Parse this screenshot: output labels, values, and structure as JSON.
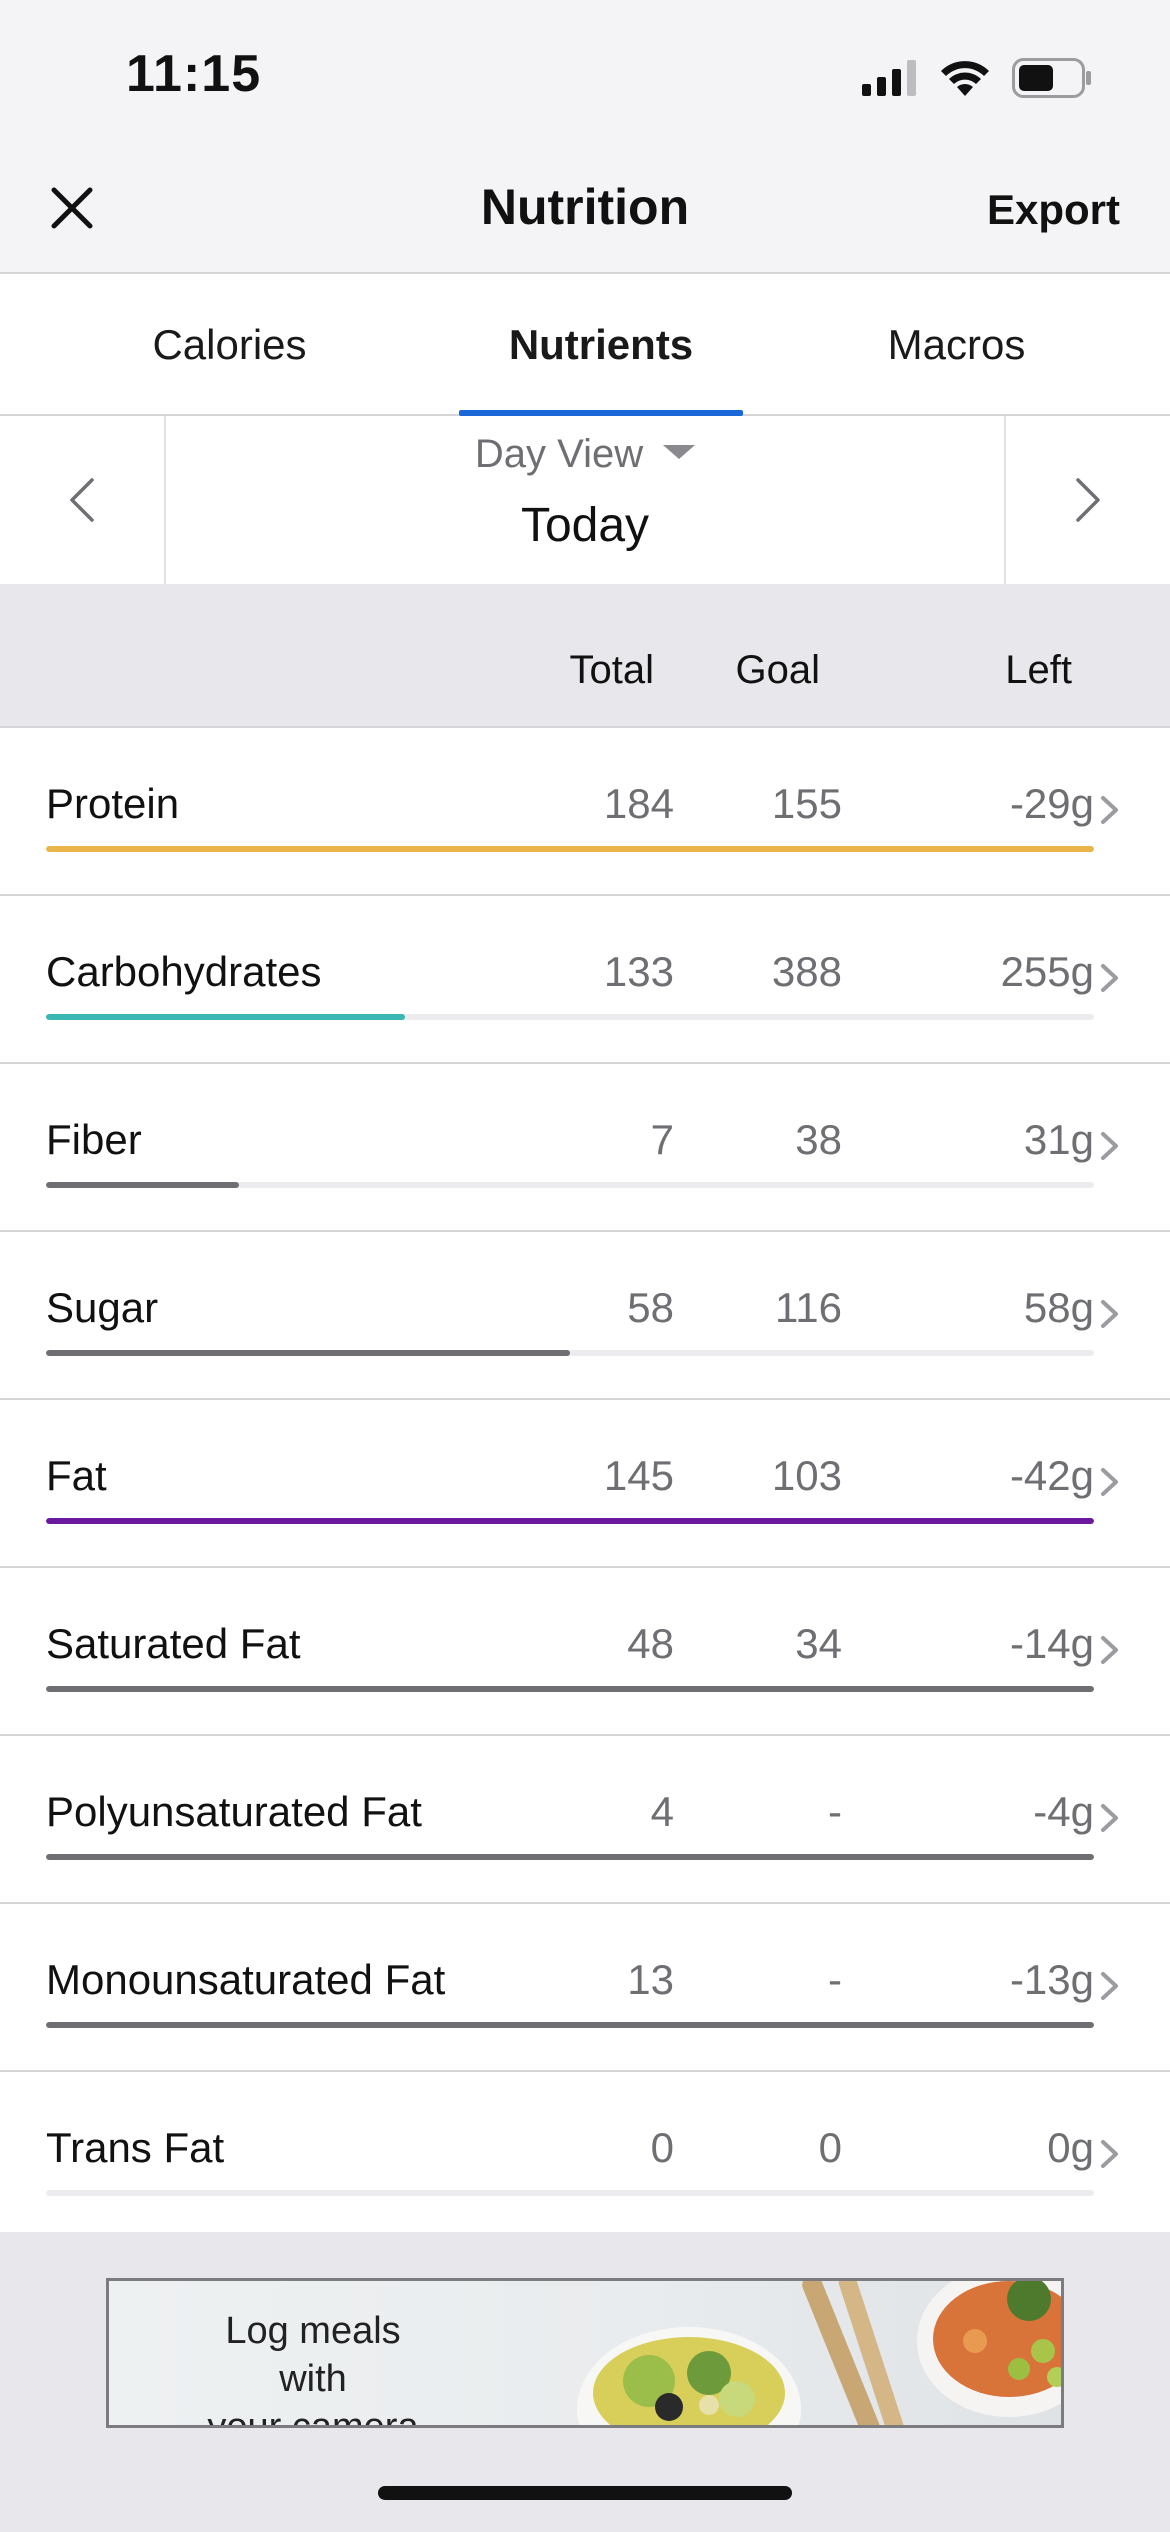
{
  "status_bar": {
    "time": "11:15"
  },
  "header": {
    "title": "Nutrition",
    "export_label": "Export"
  },
  "tabs": [
    {
      "label": "Calories",
      "active": false
    },
    {
      "label": "Nutrients",
      "active": true
    },
    {
      "label": "Macros",
      "active": false
    }
  ],
  "date_nav": {
    "view_label": "Day View",
    "day_label": "Today"
  },
  "columns": {
    "total": "Total",
    "goal": "Goal",
    "left": "Left"
  },
  "nutrients": [
    {
      "name": "Protein",
      "total": "184",
      "goal": "155",
      "left": "-29g",
      "progress": 1.0,
      "color": "#eab54a"
    },
    {
      "name": "Carbohydrates",
      "total": "133",
      "goal": "388",
      "left": "255g",
      "progress": 0.343,
      "color": "#3ab7b3"
    },
    {
      "name": "Fiber",
      "total": "7",
      "goal": "38",
      "left": "31g",
      "progress": 0.184,
      "color": "#6f6f73"
    },
    {
      "name": "Sugar",
      "total": "58",
      "goal": "116",
      "left": "58g",
      "progress": 0.5,
      "color": "#6f6f73"
    },
    {
      "name": "Fat",
      "total": "145",
      "goal": "103",
      "left": "-42g",
      "progress": 1.0,
      "color": "#6b1a9e"
    },
    {
      "name": "Saturated Fat",
      "total": "48",
      "goal": "34",
      "left": "-14g",
      "progress": 1.0,
      "color": "#6f6f73"
    },
    {
      "name": "Polyunsaturated Fat",
      "total": "4",
      "goal": "-",
      "left": "-4g",
      "progress": 1.0,
      "color": "#6f6f73"
    },
    {
      "name": "Monounsaturated Fat",
      "total": "13",
      "goal": "-",
      "left": "-13g",
      "progress": 1.0,
      "color": "#6f6f73"
    },
    {
      "name": "Trans Fat",
      "total": "0",
      "goal": "0",
      "left": "0g",
      "progress": 0.0,
      "color": "#6f6f73"
    }
  ],
  "ad": {
    "line1": "Log meals with",
    "line2": "your camera"
  },
  "icons": {
    "close": "close-icon",
    "prev": "chevron-left-icon",
    "next": "chevron-right-icon",
    "row_chevron": "chevron-right-icon"
  }
}
